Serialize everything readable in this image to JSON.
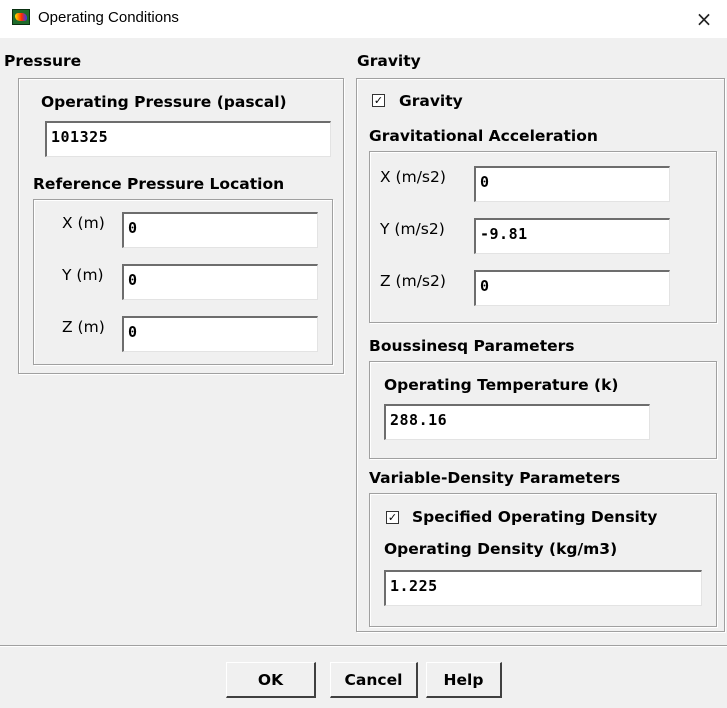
{
  "window": {
    "title": "Operating Conditions",
    "close_glyph": "×",
    "app_icon": "fluent-app-icon"
  },
  "pressure": {
    "heading": "Pressure",
    "operating_label": "Operating Pressure (pascal)",
    "operating_value": "101325",
    "reference_heading": "Reference Pressure Location",
    "x_label": "X (m)",
    "x_value": "0",
    "y_label": "Y (m)",
    "y_value": "0",
    "z_label": "Z (m)",
    "z_value": "0"
  },
  "gravity": {
    "heading": "Gravity",
    "checkbox_label": "Gravity",
    "checked": true,
    "accel_heading": "Gravitational Acceleration",
    "x_label": "X (m/s2)",
    "x_value": "0",
    "y_label": "Y (m/s2)",
    "y_value": "-9.81",
    "z_label": "Z (m/s2)",
    "z_value": "0"
  },
  "boussinesq": {
    "heading": "Boussinesq Parameters",
    "temp_label": "Operating Temperature (k)",
    "temp_value": "288.16"
  },
  "variable_density": {
    "heading": "Variable-Density Parameters",
    "checkbox_label": "Specified Operating Density",
    "checked": true,
    "density_label": "Operating Density (kg/m3)",
    "density_value": "1.225"
  },
  "buttons": {
    "ok": "OK",
    "cancel": "Cancel",
    "help": "Help"
  },
  "check_glyph": "✓"
}
